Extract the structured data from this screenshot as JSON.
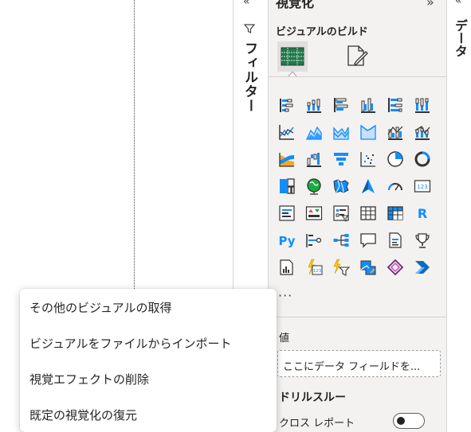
{
  "filter_pane": {
    "collapse_glyph": "«",
    "title": "フィルター",
    "icon": "funnel-icon"
  },
  "viz_pane": {
    "title": "視覚化",
    "collapse_glyph": "»",
    "build_label": "ビジュアルのビルド",
    "modes": [
      {
        "name": "build-visual",
        "icon": "table-build-icon",
        "active": true
      },
      {
        "name": "format-visual",
        "icon": "format-brush-icon",
        "active": false
      }
    ],
    "visuals": [
      "stacked-bar-icon",
      "stacked-column-icon",
      "clustered-bar-icon",
      "clustered-column-icon",
      "100-stacked-bar-icon",
      "100-stacked-column-icon",
      "line-icon",
      "area-icon",
      "stacked-area-icon",
      "ribbon-icon",
      "line-clustered-column-icon",
      "line-stacked-column-icon",
      "ribbon-chart-icon",
      "waterfall-icon",
      "funnel-chart-icon",
      "scatter-icon",
      "pie-icon",
      "donut-icon",
      "treemap-icon",
      "map-icon",
      "filled-map-icon",
      "azure-map-icon",
      "gauge-icon",
      "card-icon",
      "multi-row-card-icon",
      "kpi-icon",
      "slicer-icon",
      "table-icon",
      "matrix-icon",
      "r-script-icon",
      "python-icon",
      "key-influencers-icon",
      "decomposition-tree-icon",
      "qa-icon",
      "smart-narrative-icon",
      "trophy-icon",
      "paginated-report-icon",
      "power-apps-icon",
      "power-automate-icon",
      "shape-map-icon",
      "power-apps-diamond-icon",
      "power-automate-flow-icon"
    ],
    "more_label": "···",
    "values_label": "値",
    "values_placeholder": "ここにデータ フィールドを...",
    "drill_label": "ドリルスルー",
    "cross_report_label": "クロス レポート",
    "cross_report_on": false
  },
  "data_pane": {
    "collapse_glyph": "«",
    "title": "データ"
  },
  "context_menu": {
    "items": [
      {
        "label": "その他のビジュアルの取得"
      },
      {
        "label": "ビジュアルをファイルからインポート"
      },
      {
        "label": "視覚エフェクトの削除"
      },
      {
        "label": "既定の視覚化の復元"
      }
    ]
  },
  "colors": {
    "accent_blue": "#118dff",
    "accent_green": "#1aab40",
    "pane_bg": "#f3f2f1"
  }
}
